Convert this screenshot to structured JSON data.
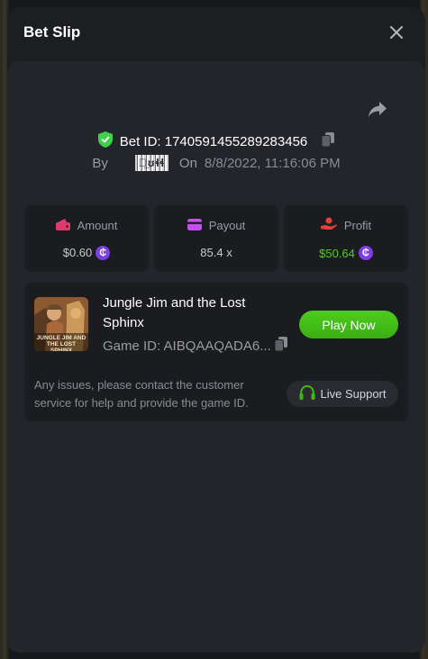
{
  "modal": {
    "title": "Bet Slip"
  },
  "bet": {
    "id_label": "Bet ID: 1740591455289283456",
    "by_label": "By",
    "user": "Ⓜ̲ʊɬɬ",
    "on_label": "On",
    "date": "8/8/2022, 11:16:06 PM"
  },
  "stats": {
    "amount": {
      "label": "Amount",
      "value": "$0.60",
      "icon": "wallet-icon",
      "color": "#e03b6f"
    },
    "payout": {
      "label": "Payout",
      "value": "85.4 x",
      "icon": "card-icon",
      "color": "#c64ef0"
    },
    "profit": {
      "label": "Profit",
      "value": "$50.64",
      "icon": "hand-coin-icon",
      "color": "#e0413b",
      "value_color": "#4dd11f"
    }
  },
  "coin_symbol": "₵",
  "game": {
    "title": "Jungle Jim and the Lost Sphinx",
    "thumb_text": "JUNGLE JIM AND THE LOST SPHINX",
    "id_label": "Game ID: AIBQAAQADA6...",
    "play_label": "Play Now",
    "notice": "Any issues, please contact the customer service for help and provide the game ID.",
    "support_label": "Live Support"
  },
  "colors": {
    "accent_green": "#3fb816",
    "shield_green": "#3fd14a",
    "coin_purple": "#7b3fe4"
  }
}
